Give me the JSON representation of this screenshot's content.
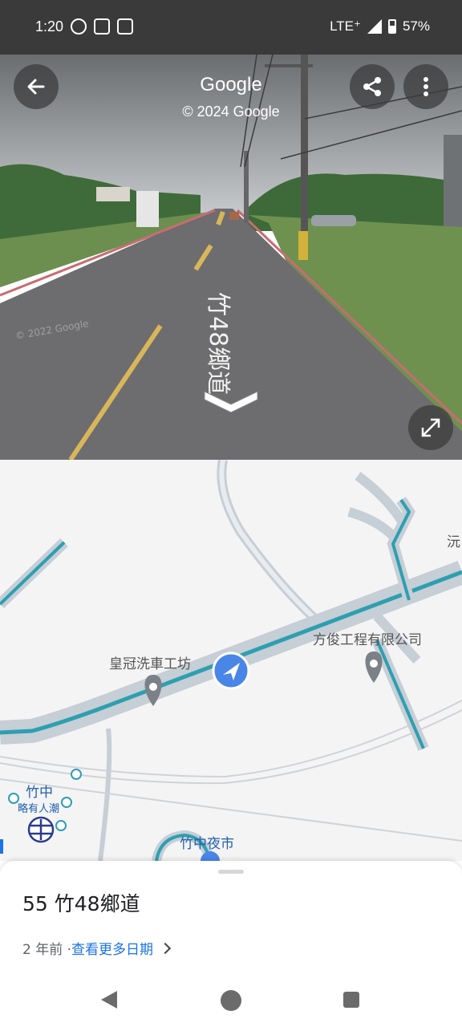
{
  "status_bar": {
    "time": "1:20",
    "network": "LTE⁺",
    "battery": "57%",
    "icons_left": [
      "check-circle-icon",
      "assistant-icon",
      "stack-icon"
    ]
  },
  "street_view": {
    "title": "Google",
    "copyright": "© 2024 Google",
    "road_marking": "竹48鄉道",
    "watermark": "© 2022 Google",
    "buttons": [
      "back-arrow-icon",
      "share-icon",
      "more-vert-icon",
      "expand-icon"
    ]
  },
  "map": {
    "labels": {
      "car_wash": "皇冠洗車工坊",
      "company": "方俊工程有限公司",
      "station": "竹中",
      "crowd": "略有人潮",
      "night_market": "竹中夜市",
      "edge": "沅"
    }
  },
  "sheet": {
    "address": "55 竹48鄉道",
    "time_ago": "2 年前 · ",
    "more_dates": "查看更多日期"
  },
  "colors": {
    "road_teal": "#2e9fb0",
    "location_blue": "#4a86e8",
    "link_blue": "#1a73e8"
  }
}
